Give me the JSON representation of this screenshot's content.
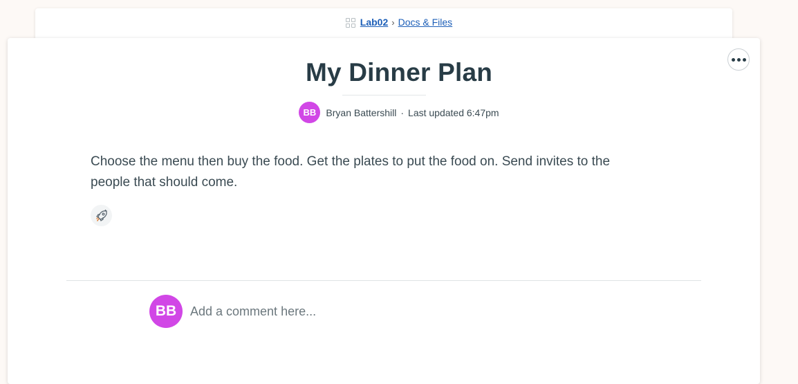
{
  "breadcrumb": {
    "icon": "grid-icon",
    "project": "Lab02",
    "separator": "›",
    "section": "Docs & Files"
  },
  "doc": {
    "title": "My Dinner Plan",
    "author_initials": "BB",
    "author_name": "Bryan Battershill",
    "separator": "·",
    "updated": "Last updated 6:47pm",
    "body": "Choose the menu then buy the food. Get the plates to put the food on. Send invites to the people that should come.",
    "boost_icon": "rocket-icon"
  },
  "menu": {
    "icon": "more-horizontal-icon"
  },
  "comment": {
    "avatar_initials": "BB",
    "placeholder": "Add a comment here..."
  },
  "colors": {
    "accent": "#d147e6",
    "link": "#1d5fb8",
    "text": "#283c46",
    "background": "#fdf9f6"
  }
}
